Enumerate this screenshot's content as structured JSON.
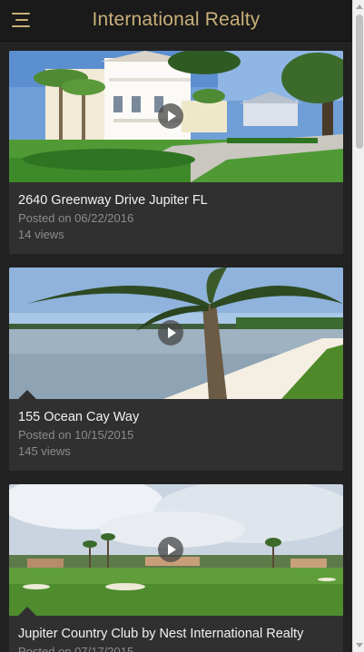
{
  "app": {
    "title": "International Realty",
    "accent_color": "#c9b07a",
    "background_color": "#222222",
    "card_color": "#303030"
  },
  "header": {
    "menu_icon": "menu-icon"
  },
  "videos": [
    {
      "title": "2640 Greenway Drive Jupiter FL",
      "posted": "Posted on 06/22/2016",
      "views": "14 views",
      "thumbnail": "house-with-palm-trees",
      "play_icon": "play-icon"
    },
    {
      "title": "155 Ocean Cay Way",
      "posted": "Posted on 10/15/2015",
      "views": "145 views",
      "thumbnail": "beach-with-palm-tree",
      "play_icon": "play-icon"
    },
    {
      "title": "Jupiter Country Club by Nest International Realty",
      "posted": "Posted on 07/17/2015",
      "views": "",
      "thumbnail": "golf-course",
      "play_icon": "play-icon"
    }
  ]
}
